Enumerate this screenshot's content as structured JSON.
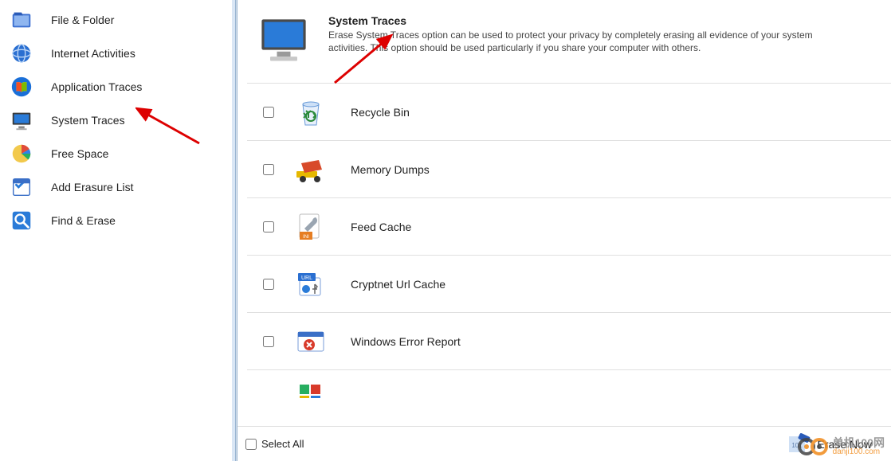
{
  "sidebar": {
    "items": [
      {
        "label": "File & Folder",
        "icon": "file-folder"
      },
      {
        "label": "Internet Activities",
        "icon": "globe"
      },
      {
        "label": "Application Traces",
        "icon": "windows"
      },
      {
        "label": "System Traces",
        "icon": "monitor"
      },
      {
        "label": "Free Space",
        "icon": "pie"
      },
      {
        "label": "Add Erasure List",
        "icon": "check-list"
      },
      {
        "label": "Find & Erase",
        "icon": "search"
      }
    ]
  },
  "header": {
    "title": "System Traces",
    "description": "Erase System Traces option can be used to protect your privacy by completely erasing all evidence of your system activities. This option should be used particularly if you share your computer with others."
  },
  "traces": [
    {
      "label": "Recycle Bin",
      "icon": "recycle-bin",
      "checked": false
    },
    {
      "label": "Memory Dumps",
      "icon": "dump-truck",
      "checked": false
    },
    {
      "label": "Feed Cache",
      "icon": "wrench-ini",
      "checked": false
    },
    {
      "label": "Cryptnet Url Cache",
      "icon": "url-badge",
      "checked": false
    },
    {
      "label": "Windows Error Report",
      "icon": "error-window",
      "checked": false
    }
  ],
  "footer": {
    "selectAllLabel": "Select All",
    "eraseNowLabel": "Erase Now"
  },
  "watermark": {
    "line1": "单机100网",
    "line2": "danji100.com"
  }
}
